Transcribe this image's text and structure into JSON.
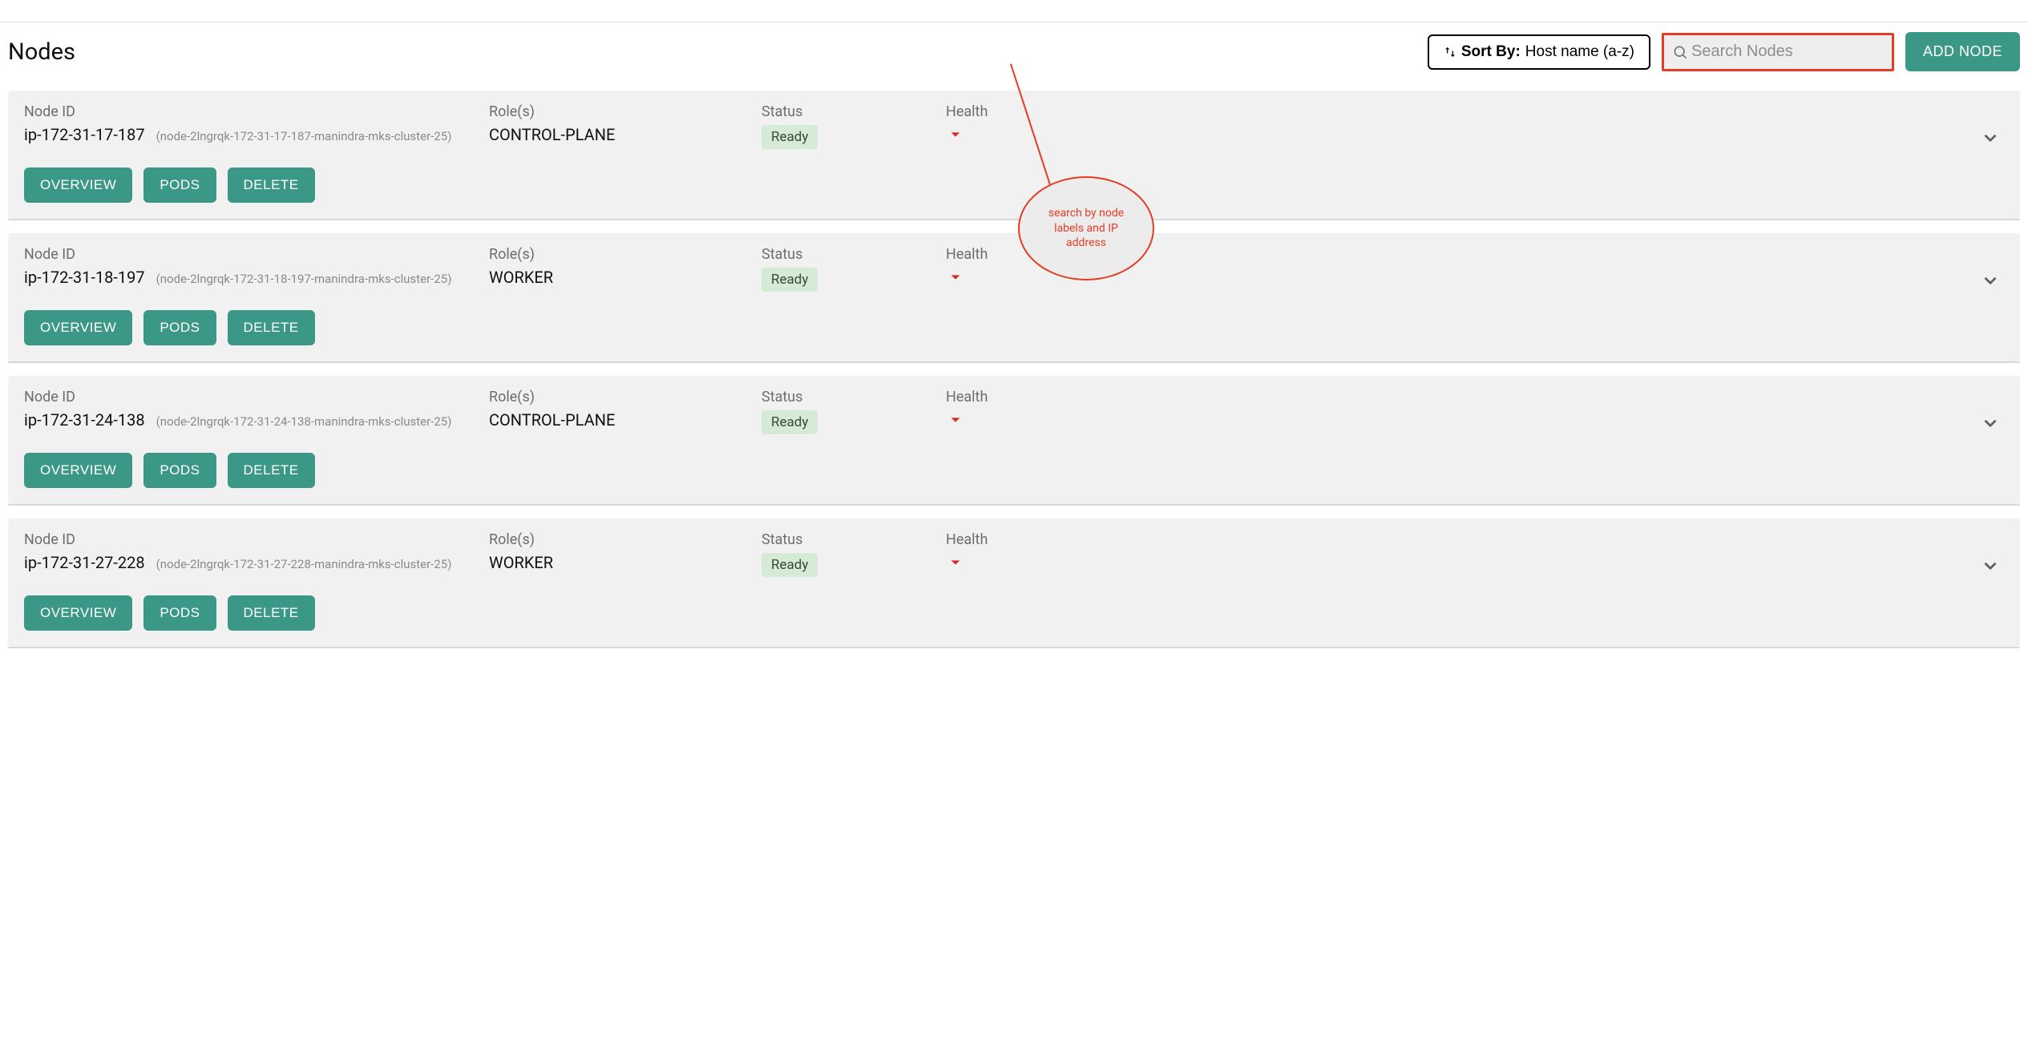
{
  "page_title": "Nodes",
  "toolbar": {
    "sort_label": "Sort By:",
    "sort_value": "Host name (a-z)",
    "search_placeholder": "Search Nodes",
    "add_node_label": "ADD NODE"
  },
  "columns": {
    "node_id": "Node ID",
    "roles": "Role(s)",
    "status": "Status",
    "health": "Health"
  },
  "actions": {
    "overview": "OVERVIEW",
    "pods": "PODS",
    "delete": "DELETE"
  },
  "annotation": "search by node labels and IP address",
  "nodes": [
    {
      "id": "ip-172-31-17-187",
      "sub": "(node-2lngrqk-172-31-17-187-manindra-mks-cluster-25)",
      "roles": "CONTROL-PLANE",
      "status": "Ready"
    },
    {
      "id": "ip-172-31-18-197",
      "sub": "(node-2lngrqk-172-31-18-197-manindra-mks-cluster-25)",
      "roles": "WORKER",
      "status": "Ready"
    },
    {
      "id": "ip-172-31-24-138",
      "sub": "(node-2lngrqk-172-31-24-138-manindra-mks-cluster-25)",
      "roles": "CONTROL-PLANE",
      "status": "Ready"
    },
    {
      "id": "ip-172-31-27-228",
      "sub": "(node-2lngrqk-172-31-27-228-manindra-mks-cluster-25)",
      "roles": "WORKER",
      "status": "Ready"
    }
  ]
}
